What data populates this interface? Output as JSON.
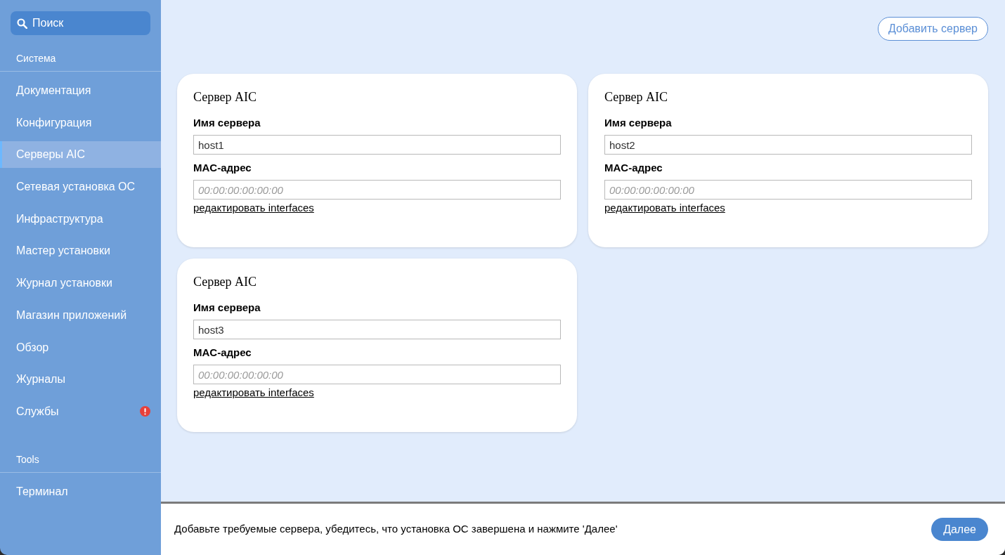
{
  "sidebar": {
    "search": {
      "placeholder": "Поиск"
    },
    "sections": [
      {
        "title": "Система",
        "items": [
          {
            "label": "Документация",
            "selected": false,
            "alert": false
          },
          {
            "label": "Конфигурация",
            "selected": false,
            "alert": false
          },
          {
            "label": "Серверы AIC",
            "selected": true,
            "alert": false
          },
          {
            "label": "Сетевая установка ОС",
            "selected": false,
            "alert": false
          },
          {
            "label": "Инфраструктура",
            "selected": false,
            "alert": false
          },
          {
            "label": "Мастер установки",
            "selected": false,
            "alert": false
          },
          {
            "label": "Журнал установки",
            "selected": false,
            "alert": false
          },
          {
            "label": "Магазин приложений",
            "selected": false,
            "alert": false
          },
          {
            "label": "Обзор",
            "selected": false,
            "alert": false
          },
          {
            "label": "Журналы",
            "selected": false,
            "alert": false
          },
          {
            "label": "Службы",
            "selected": false,
            "alert": true
          }
        ]
      },
      {
        "title": "Tools",
        "items": [
          {
            "label": "Терминал",
            "selected": false,
            "alert": false
          }
        ]
      }
    ]
  },
  "add_server_button": "Добавить сервер",
  "servers": [
    {
      "title": "Сервер AIC",
      "name_label": "Имя сервера",
      "name_value": "host1",
      "mac_label": "MAC-адрес",
      "mac_placeholder": "00:00:00:00:00:00",
      "link": "редактировать interfaces"
    },
    {
      "title": "Сервер AIC",
      "name_label": "Имя сервера",
      "name_value": "host2",
      "mac_label": "MAC-адрес",
      "mac_placeholder": "00:00:00:00:00:00",
      "link": "редактировать interfaces"
    },
    {
      "title": "Сервер AIC",
      "name_label": "Имя сервера",
      "name_value": "host3",
      "mac_label": "MAC-адрес",
      "mac_placeholder": "00:00:00:00:00:00",
      "link": "редактировать interfaces"
    }
  ],
  "footer": {
    "message": "Добавьте требуемые сервера, убедитесь, что установка ОС завершена и нажмите 'Далее'",
    "next_button": "Далее"
  }
}
